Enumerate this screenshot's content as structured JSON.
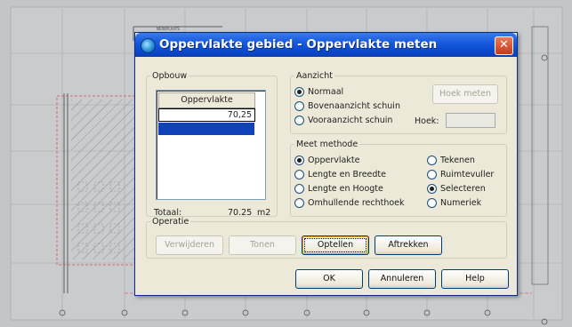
{
  "background": {
    "stamp_text": "NERKPLAATS"
  },
  "dialog": {
    "title": "Oppervlakte gebied - Oppervlakte meten",
    "close_glyph": "✕",
    "opbouw": {
      "legend": "Opbouw",
      "column_header": "Oppervlakte",
      "rows": [
        "70,25"
      ],
      "total_label": "Totaal:",
      "total_value": "70.25",
      "total_unit": "m2"
    },
    "aanzicht": {
      "legend": "Aanzicht",
      "options": [
        "Normaal",
        "Bovenaanzicht schuin",
        "Vooraanzicht schuin"
      ],
      "selected": 0,
      "hoek_meten_button": "Hoek meten",
      "hoek_label": "Hoek:",
      "hoek_value": ""
    },
    "meet_methode": {
      "legend": "Meet methode",
      "left_options": [
        "Oppervlakte",
        "Lengte en Breedte",
        "Lengte en Hoogte",
        "Omhullende rechthoek"
      ],
      "right_options": [
        "Tekenen",
        "Ruimtevuller",
        "Selecteren",
        "Numeriek"
      ],
      "selected_left": 0,
      "selected_right": 2
    },
    "operatie": {
      "legend": "Operatie",
      "buttons": [
        "Verwijderen",
        "Tonen",
        "Optellen",
        "Aftrekken"
      ]
    },
    "footer": {
      "ok": "OK",
      "annuleren": "Annuleren",
      "help": "Help"
    }
  },
  "colors": {
    "title_bar": "#0a4bd2",
    "dialog_bg": "#ece9d8",
    "selection": "#1143b8",
    "close_button": "#c83a1c"
  }
}
